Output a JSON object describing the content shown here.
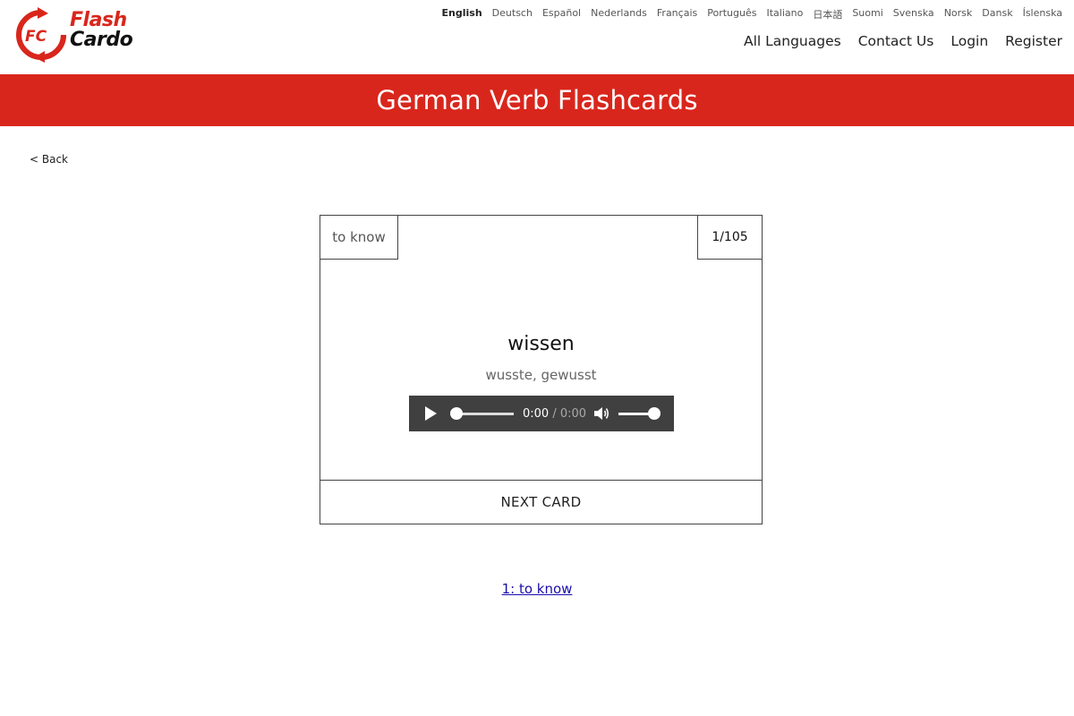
{
  "logo": {
    "line1": "Flash",
    "line2": "Cardo"
  },
  "languages": [
    "English",
    "Deutsch",
    "Español",
    "Nederlands",
    "Français",
    "Português",
    "Italiano",
    "日本語",
    "Suomi",
    "Svenska",
    "Norsk",
    "Dansk",
    "Íslenska"
  ],
  "active_language": "English",
  "nav": {
    "all_languages": "All Languages",
    "contact": "Contact Us",
    "login": "Login",
    "register": "Register"
  },
  "banner": {
    "title": "German Verb Flashcards"
  },
  "back": "< Back",
  "card": {
    "english": "to know",
    "counter": "1/105",
    "word": "wissen",
    "forms": "wusste, gewusst",
    "next_label": "NEXT CARD"
  },
  "player": {
    "current_time": "0:00",
    "separator": " / ",
    "duration": "0:00",
    "progress": 0.0,
    "volume": 1.0
  },
  "list_link": "1: to know",
  "colors": {
    "brand_red": "#d9261c",
    "player_bg": "#404040",
    "link": "#1a0dab"
  }
}
